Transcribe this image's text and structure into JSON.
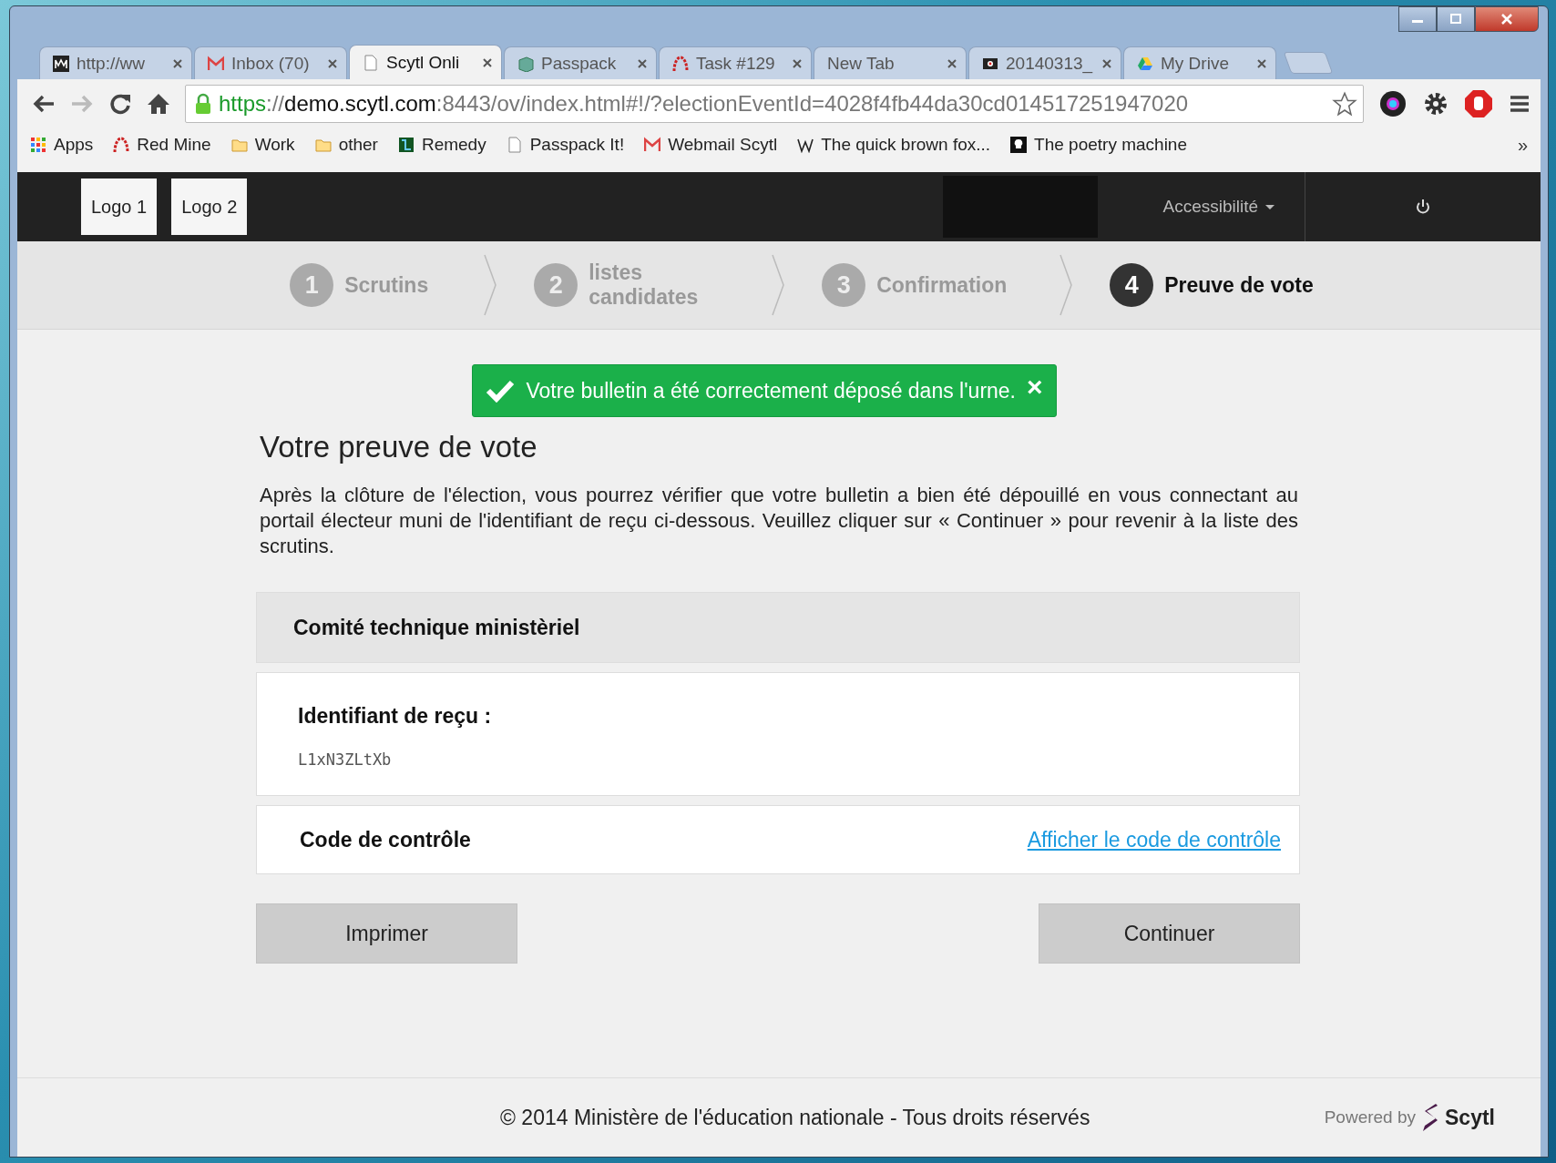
{
  "browser": {
    "tabs": [
      {
        "label": "http://ww",
        "kind": "m",
        "selected": false
      },
      {
        "label": "Inbox (70)",
        "kind": "mail",
        "selected": false
      },
      {
        "label": "Scytl Onli",
        "kind": "page",
        "selected": true
      },
      {
        "label": "Passpack",
        "kind": "box",
        "selected": false
      },
      {
        "label": "Task #129",
        "kind": "arc",
        "selected": false
      },
      {
        "label": "New Tab",
        "kind": "none",
        "selected": false
      },
      {
        "label": "20140313_",
        "kind": "film",
        "selected": false
      },
      {
        "label": "My Drive",
        "kind": "drive",
        "selected": false
      }
    ],
    "url": {
      "scheme": "https",
      "separator": "://",
      "host": "demo.scytl.com",
      "rest": ":8443/ov/index.html#!/?electionEventId=4028f4fb44da30cd014517251947020"
    },
    "bookmarks": [
      {
        "label": "Apps",
        "kind": "grid"
      },
      {
        "label": "Red Mine",
        "kind": "arc"
      },
      {
        "label": "Work",
        "kind": "folder"
      },
      {
        "label": "other",
        "kind": "folder"
      },
      {
        "label": "Remedy",
        "kind": "remedy"
      },
      {
        "label": "Passpack It!",
        "kind": "page"
      },
      {
        "label": "Webmail Scytl",
        "kind": "mail"
      },
      {
        "label": "The quick brown fox...",
        "kind": "w"
      },
      {
        "label": "The poetry machine",
        "kind": "bulb"
      }
    ],
    "more": "»"
  },
  "header": {
    "logos": [
      "Logo 1",
      "Logo 2"
    ],
    "accessibility": "Accessibilité"
  },
  "steps": [
    {
      "number": "1",
      "label": "Scrutins",
      "selected": false
    },
    {
      "number": "2",
      "label": "listes candidates",
      "selected": false
    },
    {
      "number": "3",
      "label": "Confirmation",
      "selected": false
    },
    {
      "number": "4",
      "label": "Preuve de vote",
      "selected": true
    }
  ],
  "alert": {
    "text": "Votre bulletin a été correctement déposé dans l'urne.",
    "close": "×"
  },
  "title": "Votre preuve de vote",
  "intro": "Après la clôture de l'élection, vous pourrez vérifier que votre bulletin a bien été dépouillé en vous connectant au portail électeur muni de l'identifiant de reçu ci-dessous. Veuillez cliquer sur « Continuer » pour revenir à la liste des scrutins.",
  "election": "Comité technique ministèriel",
  "receipt": {
    "label": "Identifiant de reçu :",
    "value": "L1xN3ZLtXb"
  },
  "control": {
    "label": "Code de contrôle",
    "link": "Afficher le code de contrôle"
  },
  "buttons": [
    "Imprimer",
    "Continuer"
  ],
  "footer": {
    "copyright": "© 2014 Ministère de l'éducation nationale - Tous droits réservés",
    "powered": "Powered by",
    "brand": "Scytl"
  }
}
